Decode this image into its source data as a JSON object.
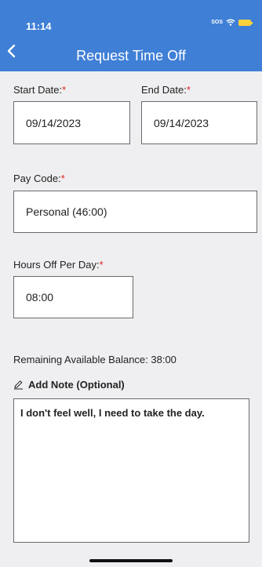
{
  "status_bar": {
    "time": "11:14",
    "sos": "SOS",
    "battery_color": "#ffd23a"
  },
  "header": {
    "title": "Request Time Off",
    "background": "#3f7fd6",
    "back_icon": "chevron-left-icon"
  },
  "form": {
    "start_date": {
      "label": "Start Date:",
      "required_mark": "*",
      "value": "09/14/2023"
    },
    "end_date": {
      "label": "End Date:",
      "required_mark": "*",
      "value": "09/14/2023"
    },
    "pay_code": {
      "label": "Pay Code:",
      "required_mark": "*",
      "value": "Personal (46:00)"
    },
    "hours_off": {
      "label": "Hours Off Per Day:",
      "required_mark": "*",
      "value": "08:00"
    },
    "balance_text": "Remaining Available Balance: 38:00",
    "note": {
      "label": "Add Note (Optional)",
      "icon": "pencil-icon",
      "value": "I don't feel well, I need to take the day."
    }
  },
  "colors": {
    "required": "#e02020",
    "field_border": "#6a6a6a"
  }
}
